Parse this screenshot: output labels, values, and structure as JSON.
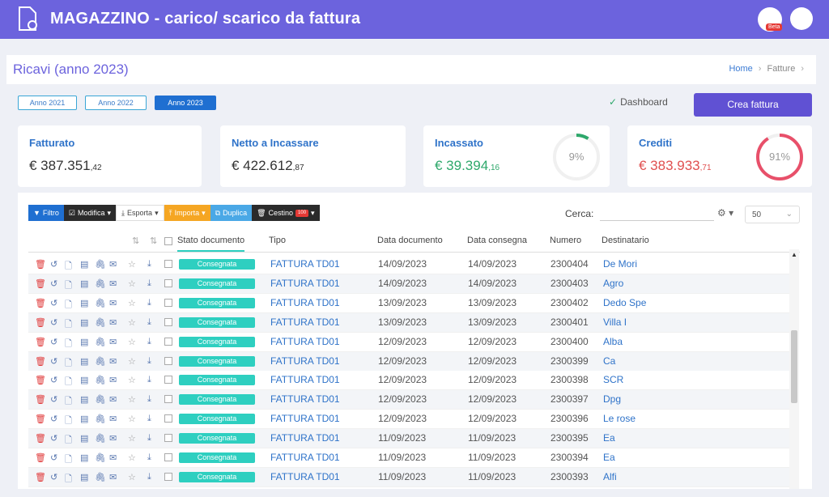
{
  "app": {
    "title": "MAGAZZINO - carico/ scarico da fattura",
    "beta": "Beta"
  },
  "page": {
    "title": "Ricavi (anno 2023)"
  },
  "breadcrumb": {
    "home": "Home",
    "current": "Fatture"
  },
  "years": [
    "Anno 2021",
    "Anno 2022",
    "Anno 2023"
  ],
  "dashboard": "Dashboard",
  "crea": "Crea fattura",
  "cards": {
    "fatturato": {
      "label": "Fatturato",
      "value": "€ 387.351",
      "dec": ",42"
    },
    "netto": {
      "label": "Netto a Incassare",
      "value": "€ 422.612",
      "dec": ",87"
    },
    "incassato": {
      "label": "Incassato",
      "value": "€ 39.394",
      "dec": ",16",
      "pct": "9%",
      "pct_value": 0.09
    },
    "crediti": {
      "label": "Crediti",
      "value": "€ 383.933",
      "dec": ",71",
      "pct": "91%",
      "pct_value": 0.91
    }
  },
  "toolbar": {
    "filtro": "Filtro",
    "modifica": "Modifica",
    "esporta": "Esporta",
    "importa": "Importa",
    "duplica": "Duplica",
    "cestino": "Cestino",
    "cestino_badge": "100"
  },
  "search": {
    "label": "Cerca:",
    "perpage": "50"
  },
  "columns": [
    "Stato documento",
    "Tipo",
    "Data documento",
    "Data consegna",
    "Numero",
    "Destinatario"
  ],
  "rows": [
    {
      "stato": "Consegnata",
      "tipo": "FATTURA TD01",
      "ddoc": "14/09/2023",
      "dcon": "14/09/2023",
      "num": "2300404",
      "dest": "De Mori"
    },
    {
      "stato": "Consegnata",
      "tipo": "FATTURA TD01",
      "ddoc": "14/09/2023",
      "dcon": "14/09/2023",
      "num": "2300403",
      "dest": "Agro"
    },
    {
      "stato": "Consegnata",
      "tipo": "FATTURA TD01",
      "ddoc": "13/09/2023",
      "dcon": "13/09/2023",
      "num": "2300402",
      "dest": "Dedo Spe"
    },
    {
      "stato": "Consegnata",
      "tipo": "FATTURA TD01",
      "ddoc": "13/09/2023",
      "dcon": "13/09/2023",
      "num": "2300401",
      "dest": "Villa I"
    },
    {
      "stato": "Consegnata",
      "tipo": "FATTURA TD01",
      "ddoc": "12/09/2023",
      "dcon": "12/09/2023",
      "num": "2300400",
      "dest": "Alba"
    },
    {
      "stato": "Consegnata",
      "tipo": "FATTURA TD01",
      "ddoc": "12/09/2023",
      "dcon": "12/09/2023",
      "num": "2300399",
      "dest": "Ca"
    },
    {
      "stato": "Consegnata",
      "tipo": "FATTURA TD01",
      "ddoc": "12/09/2023",
      "dcon": "12/09/2023",
      "num": "2300398",
      "dest": "SCR"
    },
    {
      "stato": "Consegnata",
      "tipo": "FATTURA TD01",
      "ddoc": "12/09/2023",
      "dcon": "12/09/2023",
      "num": "2300397",
      "dest": "Dpg"
    },
    {
      "stato": "Consegnata",
      "tipo": "FATTURA TD01",
      "ddoc": "12/09/2023",
      "dcon": "12/09/2023",
      "num": "2300396",
      "dest": "Le rose"
    },
    {
      "stato": "Consegnata",
      "tipo": "FATTURA TD01",
      "ddoc": "11/09/2023",
      "dcon": "11/09/2023",
      "num": "2300395",
      "dest": "Ea"
    },
    {
      "stato": "Consegnata",
      "tipo": "FATTURA TD01",
      "ddoc": "11/09/2023",
      "dcon": "11/09/2023",
      "num": "2300394",
      "dest": "Ea"
    },
    {
      "stato": "Consegnata",
      "tipo": "FATTURA TD01",
      "ddoc": "11/09/2023",
      "dcon": "11/09/2023",
      "num": "2300393",
      "dest": "Alfi"
    }
  ]
}
